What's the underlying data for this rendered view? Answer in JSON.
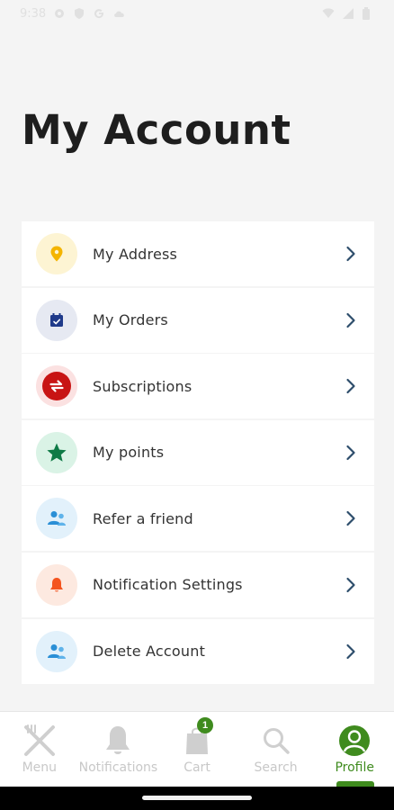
{
  "status_bar": {
    "time": "9:38"
  },
  "header": {
    "title": "My Account"
  },
  "menu": {
    "items": [
      {
        "label": "My Address",
        "icon": "location-pin-icon",
        "bg": "#fdf4d3",
        "color": "#f4b400"
      },
      {
        "label": "My Orders",
        "icon": "calendar-icon",
        "bg": "#e6e9f2",
        "color": "#1f3a8a"
      },
      {
        "label": "Subscriptions",
        "icon": "repeat-icon",
        "bg": "#fbe1e1",
        "color": "#c81414"
      },
      {
        "label": "My points",
        "icon": "star-icon",
        "bg": "#daf3e6",
        "color": "#0e7a46"
      },
      {
        "label": "Refer a friend",
        "icon": "users-icon",
        "bg": "#e2f1fb",
        "color": "#2a8fd6"
      },
      {
        "label": "Notification Settings",
        "icon": "bell-icon",
        "bg": "#fde9e0",
        "color": "#f4541f"
      },
      {
        "label": "Delete Account",
        "icon": "users-icon",
        "bg": "#e2f1fb",
        "color": "#2a8fd6"
      }
    ]
  },
  "bottom_nav": {
    "items": [
      {
        "label": "Menu",
        "icon": "fork-knife-icon"
      },
      {
        "label": "Notifications",
        "icon": "bell-icon"
      },
      {
        "label": "Cart",
        "icon": "bag-icon",
        "badge": "1"
      },
      {
        "label": "Search",
        "icon": "search-icon"
      },
      {
        "label": "Profile",
        "icon": "profile-icon",
        "active": true
      }
    ],
    "active_color": "#3f8b1e",
    "inactive_color": "#c8c8c8"
  }
}
